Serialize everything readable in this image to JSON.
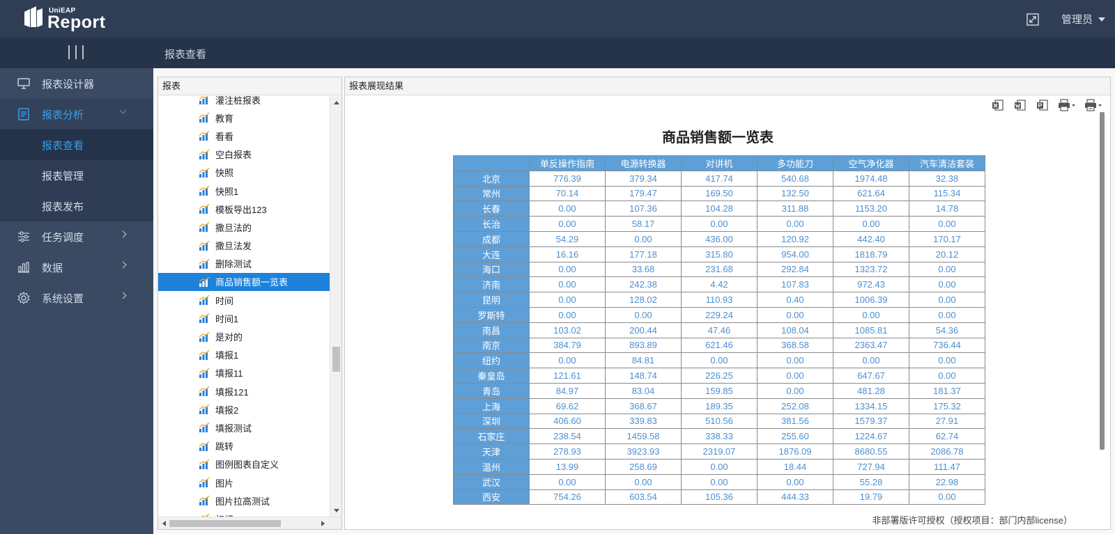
{
  "app": {
    "logo_small": "UniEAP",
    "logo_big": "Report"
  },
  "header": {
    "user": "管理员"
  },
  "breadcrumb": "报表查看",
  "sidebar": {
    "items": [
      {
        "label": "报表设计器",
        "icon": "monitor-icon"
      },
      {
        "label": "报表分析",
        "icon": "document-icon",
        "active": true
      },
      {
        "label": "任务调度",
        "icon": "sliders-icon"
      },
      {
        "label": "数据",
        "icon": "bar-chart-icon"
      },
      {
        "label": "系统设置",
        "icon": "gear-icon"
      }
    ],
    "subitems": [
      "报表查看",
      "报表管理",
      "报表发布"
    ]
  },
  "tree_panel": {
    "title": "报表",
    "items": [
      "灌注桩报表",
      "教育",
      "看看",
      "空白报表",
      "快照",
      "快照1",
      "模板导出123",
      "撒旦法的",
      "撒旦法发",
      "删除测试",
      "商品销售额一览表",
      "时间",
      "时间1",
      "是对的",
      "填报1",
      "填报11",
      "填报121",
      "填报2",
      "填报测试",
      "跳转",
      "图例图表自定义",
      "图片",
      "图片拉高测试",
      "标记"
    ],
    "selected_index": 10
  },
  "report_panel": {
    "title": "报表展现结果",
    "report_title": "商品销售额一览表",
    "columns": [
      "单反操作指南",
      "电源转换器",
      "对讲机",
      "多功能刀",
      "空气净化器",
      "汽车清洁套装"
    ],
    "rows": [
      {
        "city": "北京",
        "values": [
          "776.39",
          "379.34",
          "417.74",
          "540.68",
          "1974.48",
          "32.38"
        ]
      },
      {
        "city": "常州",
        "values": [
          "70.14",
          "179.47",
          "169.50",
          "132.50",
          "621.64",
          "115.34"
        ]
      },
      {
        "city": "长春",
        "values": [
          "0.00",
          "107.36",
          "104.28",
          "311.88",
          "1153.20",
          "14.78"
        ]
      },
      {
        "city": "长治",
        "values": [
          "0.00",
          "58.17",
          "0.00",
          "0.00",
          "0.00",
          "0.00"
        ]
      },
      {
        "city": "成都",
        "values": [
          "54.29",
          "0.00",
          "436.00",
          "120.92",
          "442.40",
          "170.17"
        ]
      },
      {
        "city": "大连",
        "values": [
          "16.16",
          "177.18",
          "315.80",
          "954.00",
          "1818.79",
          "20.12"
        ]
      },
      {
        "city": "海口",
        "values": [
          "0.00",
          "33.68",
          "231.68",
          "292.84",
          "1323.72",
          "0.00"
        ]
      },
      {
        "city": "济南",
        "values": [
          "0.00",
          "242.38",
          "4.42",
          "107.83",
          "972.43",
          "0.00"
        ]
      },
      {
        "city": "昆明",
        "values": [
          "0.00",
          "128.02",
          "110.93",
          "0.40",
          "1006.39",
          "0.00"
        ]
      },
      {
        "city": "罗斯特",
        "values": [
          "0.00",
          "0.00",
          "229.24",
          "0.00",
          "0.00",
          "0.00"
        ]
      },
      {
        "city": "南昌",
        "values": [
          "103.02",
          "200.44",
          "47.46",
          "108.04",
          "1085.81",
          "54.36"
        ]
      },
      {
        "city": "南京",
        "values": [
          "384.79",
          "893.89",
          "621.46",
          "368.58",
          "2363.47",
          "736.44"
        ]
      },
      {
        "city": "纽约",
        "values": [
          "0.00",
          "84.81",
          "0.00",
          "0.00",
          "0.00",
          "0.00"
        ]
      },
      {
        "city": "秦皇岛",
        "values": [
          "121.61",
          "148.74",
          "226.25",
          "0.00",
          "647.67",
          "0.00"
        ]
      },
      {
        "city": "青岛",
        "values": [
          "84.97",
          "83.04",
          "159.85",
          "0.00",
          "481.28",
          "181.37"
        ]
      },
      {
        "city": "上海",
        "values": [
          "69.62",
          "368.67",
          "189.35",
          "252.08",
          "1334.15",
          "175.32"
        ]
      },
      {
        "city": "深圳",
        "values": [
          "406.60",
          "339.83",
          "510.56",
          "381.56",
          "1579.37",
          "27.91"
        ]
      },
      {
        "city": "石家庄",
        "values": [
          "238.54",
          "1459.58",
          "338.33",
          "255.60",
          "1224.67",
          "62.74"
        ]
      },
      {
        "city": "天津",
        "values": [
          "278.93",
          "3923.93",
          "2319.07",
          "1876.09",
          "8680.55",
          "2086.78"
        ]
      },
      {
        "city": "温州",
        "values": [
          "13.99",
          "258.69",
          "0.00",
          "18.44",
          "727.94",
          "111.47"
        ]
      },
      {
        "city": "武汉",
        "values": [
          "0.00",
          "0.00",
          "0.00",
          "0.00",
          "55.28",
          "22.98"
        ]
      },
      {
        "city": "西安",
        "values": [
          "754.26",
          "603.54",
          "105.36",
          "444.33",
          "19.79",
          "0.00"
        ]
      }
    ],
    "license": "非部署版许可授权（授权项目：部门内部license）",
    "toolbar": [
      "export-excel-icon",
      "export-word-icon",
      "export-pdf-icon",
      "print-icon",
      "print-preview-icon"
    ]
  },
  "colors": {
    "topbar": "#2f3e55",
    "sidebar": "#3a4a63",
    "accent": "#3a9ee8",
    "table_header": "#5e9fd8",
    "selected_tree": "#1e82db"
  }
}
